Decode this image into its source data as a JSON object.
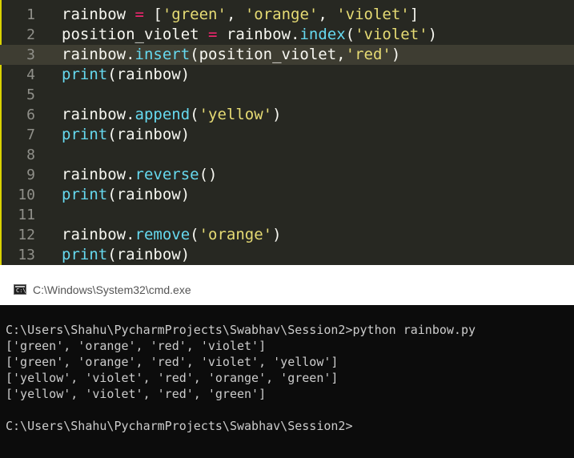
{
  "editor": {
    "lines": [
      {
        "num": "1",
        "tokens": [
          {
            "t": "rainbow "
          },
          {
            "t": "=",
            "c": "op"
          },
          {
            "t": " ["
          },
          {
            "t": "'green'",
            "c": "s"
          },
          {
            "t": ", "
          },
          {
            "t": "'orange'",
            "c": "s"
          },
          {
            "t": ", "
          },
          {
            "t": "'violet'",
            "c": "s"
          },
          {
            "t": "]"
          }
        ]
      },
      {
        "num": "2",
        "tokens": [
          {
            "t": "position_violet "
          },
          {
            "t": "=",
            "c": "op"
          },
          {
            "t": " rainbow."
          },
          {
            "t": "index",
            "c": "f"
          },
          {
            "t": "("
          },
          {
            "t": "'violet'",
            "c": "s"
          },
          {
            "t": ")"
          }
        ]
      },
      {
        "num": "3",
        "current": true,
        "tokens": [
          {
            "t": "rainbow."
          },
          {
            "t": "insert",
            "c": "f"
          },
          {
            "t": "(position_violet,"
          },
          {
            "t": "'red'",
            "c": "s"
          },
          {
            "t": ")"
          }
        ]
      },
      {
        "num": "4",
        "tokens": [
          {
            "t": "print",
            "c": "f"
          },
          {
            "t": "(rainbow)"
          }
        ]
      },
      {
        "num": "5",
        "tokens": []
      },
      {
        "num": "6",
        "tokens": [
          {
            "t": "rainbow."
          },
          {
            "t": "append",
            "c": "f"
          },
          {
            "t": "("
          },
          {
            "t": "'yellow'",
            "c": "s"
          },
          {
            "t": ")"
          }
        ]
      },
      {
        "num": "7",
        "tokens": [
          {
            "t": "print",
            "c": "f"
          },
          {
            "t": "(rainbow)"
          }
        ]
      },
      {
        "num": "8",
        "tokens": []
      },
      {
        "num": "9",
        "tokens": [
          {
            "t": "rainbow."
          },
          {
            "t": "reverse",
            "c": "f"
          },
          {
            "t": "()"
          }
        ]
      },
      {
        "num": "10",
        "tokens": [
          {
            "t": "print",
            "c": "f"
          },
          {
            "t": "(rainbow)"
          }
        ]
      },
      {
        "num": "11",
        "tokens": []
      },
      {
        "num": "12",
        "tokens": [
          {
            "t": "rainbow."
          },
          {
            "t": "remove",
            "c": "f"
          },
          {
            "t": "("
          },
          {
            "t": "'orange'",
            "c": "s"
          },
          {
            "t": ")"
          }
        ]
      },
      {
        "num": "13",
        "tokens": [
          {
            "t": "print",
            "c": "f"
          },
          {
            "t": "(rainbow)"
          }
        ]
      }
    ]
  },
  "console": {
    "icon": "cmd-console-icon",
    "icon_glyph": "C:\\",
    "title": "C:\\Windows\\System32\\cmd.exe",
    "lines": [
      "",
      "C:\\Users\\Shahu\\PycharmProjects\\Swabhav\\Session2>python rainbow.py",
      "['green', 'orange', 'red', 'violet']",
      "['green', 'orange', 'red', 'violet', 'yellow']",
      "['yellow', 'violet', 'red', 'orange', 'green']",
      "['yellow', 'violet', 'red', 'green']",
      "",
      "C:\\Users\\Shahu\\PycharmProjects\\Swabhav\\Session2>"
    ]
  },
  "colors": {
    "editor_bg": "#272822",
    "current_line": "#3e3d32",
    "string": "#e6db74",
    "function": "#66d9ef",
    "operator": "#f92672",
    "console_bg": "#0c0c0c",
    "console_text": "#cccccc"
  }
}
